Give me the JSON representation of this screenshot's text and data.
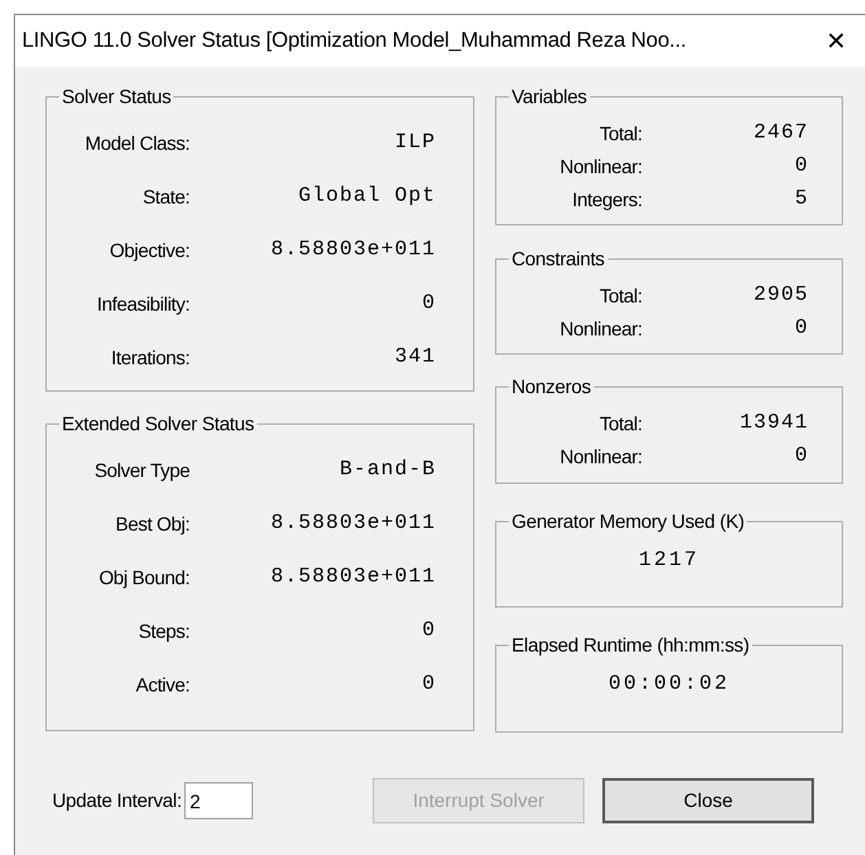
{
  "window": {
    "title": "LINGO 11.0 Solver Status [Optimization Model_Muhammad Reza Noo...",
    "close": "✕"
  },
  "left_groups": [
    {
      "kind": "table",
      "title": "Solver Status",
      "rows": [
        {
          "label": "Model Class:",
          "value": "ILP"
        },
        {
          "label": "State:",
          "value": "Global Opt"
        },
        {
          "label": "Objective:",
          "value": "8.58803e+011"
        },
        {
          "label": "Infeasibility:",
          "value": "0"
        },
        {
          "label": "Iterations:",
          "value": "341"
        }
      ]
    },
    {
      "kind": "table",
      "title": "Extended Solver Status",
      "rows": [
        {
          "label": "Solver Type",
          "value": "B-and-B"
        },
        {
          "label": "Best Obj:",
          "value": "8.58803e+011"
        },
        {
          "label": "Obj Bound:",
          "value": "8.58803e+011"
        },
        {
          "label": "Steps:",
          "value": "0"
        },
        {
          "label": "Active:",
          "value": "0"
        }
      ]
    }
  ],
  "right_groups": [
    {
      "kind": "table",
      "title": "Variables",
      "rows": [
        {
          "label": "Total:",
          "value": "2467"
        },
        {
          "label": "Nonlinear:",
          "value": "0"
        },
        {
          "label": "Integers:",
          "value": "5"
        }
      ]
    },
    {
      "kind": "table",
      "title": "Constraints",
      "rows": [
        {
          "label": "Total:",
          "value": "2905"
        },
        {
          "label": "Nonlinear:",
          "value": "0"
        }
      ]
    },
    {
      "kind": "table",
      "title": "Nonzeros",
      "rows": [
        {
          "label": "Total:",
          "value": "13941"
        },
        {
          "label": "Nonlinear:",
          "value": "0"
        }
      ]
    },
    {
      "kind": "single",
      "title": "Generator Memory Used (K)",
      "value": "1217"
    },
    {
      "kind": "single",
      "title": "Elapsed Runtime (hh:mm:ss)",
      "value": "00:00:02"
    }
  ],
  "update_interval": {
    "label": "Update Interval:",
    "value": "2"
  },
  "buttons": [
    {
      "label": "Interrupt Solver",
      "disabled": true,
      "default": false
    },
    {
      "label": "Close",
      "disabled": false,
      "default": true
    }
  ]
}
